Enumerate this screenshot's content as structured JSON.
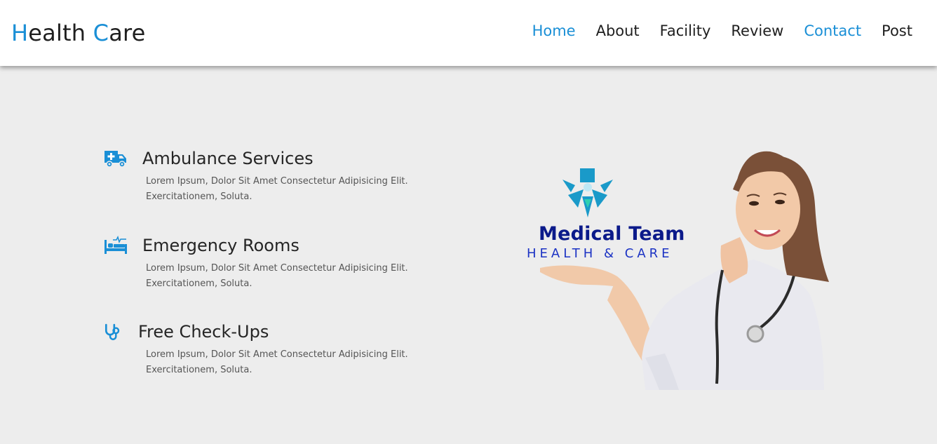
{
  "header": {
    "logo_h": "H",
    "logo_rest1": "ealth ",
    "logo_c": "C",
    "logo_rest2": "are",
    "nav": [
      {
        "label": "Home"
      },
      {
        "label": "About"
      },
      {
        "label": "Facility"
      },
      {
        "label": "Review"
      },
      {
        "label": "Contact"
      },
      {
        "label": "Post"
      }
    ]
  },
  "services": [
    {
      "title": "Ambulance Services",
      "icon": "ambulance-icon",
      "desc_line1": "Lorem Ipsum, Dolor Sit Amet Consectetur Adipisicing Elit.",
      "desc_line2": "Exercitationem, Soluta."
    },
    {
      "title": "Emergency Rooms",
      "icon": "hospital-bed-icon",
      "desc_line1": "Lorem Ipsum, Dolor Sit Amet Consectetur Adipisicing Elit.",
      "desc_line2": "Exercitationem, Soluta."
    },
    {
      "title": "Free Check-Ups",
      "icon": "stethoscope-icon",
      "desc_line1": "Lorem Ipsum, Dolor Sit Amet Consectetur Adipisicing Elit.",
      "desc_line2": "Exercitationem, Soluta."
    }
  ],
  "hero": {
    "brand_line1": "Medical Team",
    "brand_line2": "HEALTH & CARE"
  },
  "colors": {
    "accent": "#1a8fd6",
    "background": "#ededed",
    "brand_dark": "#0b1a8a",
    "brand_blue": "#1c33c4"
  }
}
